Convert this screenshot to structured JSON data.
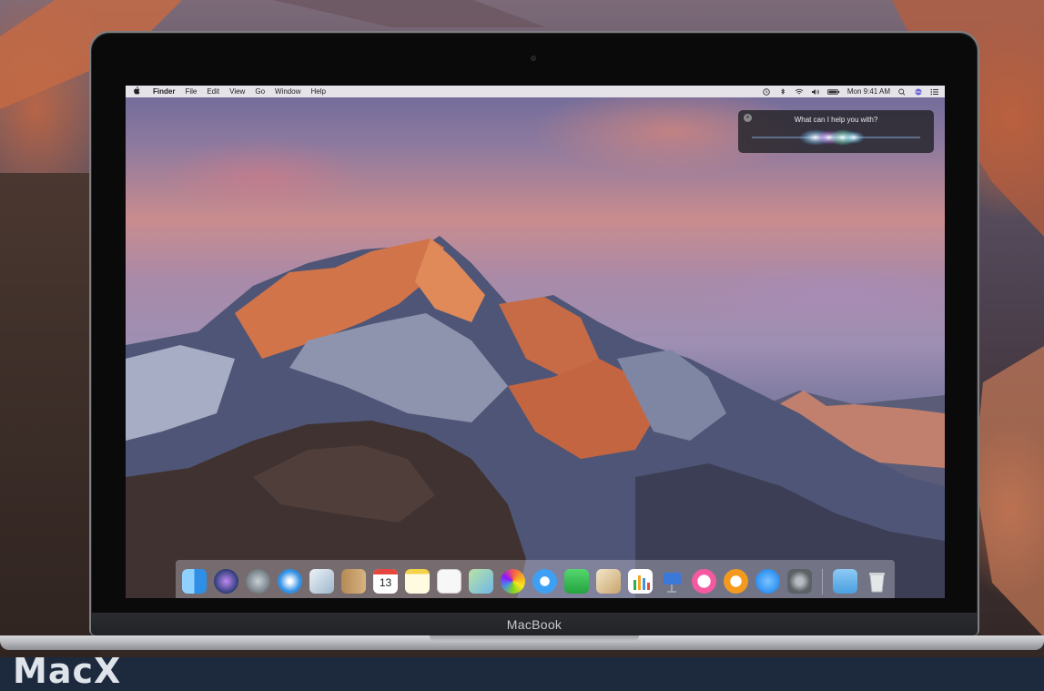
{
  "menubar": {
    "apple_label": "",
    "items": [
      "Finder",
      "File",
      "Edit",
      "View",
      "Go",
      "Window",
      "Help"
    ],
    "clock": "Mon 9:41 AM"
  },
  "siri": {
    "prompt": "What can I help you with?"
  },
  "device": {
    "label": "MacBook"
  },
  "watermark": {
    "text": "MacX"
  },
  "dock": {
    "apps": [
      {
        "name": "finder-icon",
        "color": "#4aa7f0"
      },
      {
        "name": "siri-icon",
        "color": "#2a3a78"
      },
      {
        "name": "launchpad-icon",
        "color": "#9aa4ae"
      },
      {
        "name": "safari-icon",
        "color": "#2f8fe6"
      },
      {
        "name": "mail-icon",
        "color": "#d9e2ea"
      },
      {
        "name": "contacts-icon",
        "color": "#c9a26a"
      },
      {
        "name": "calendar-icon",
        "color": "#ffffff"
      },
      {
        "name": "notes-icon",
        "color": "#f6e27a"
      },
      {
        "name": "reminders-icon",
        "color": "#f5f5f5"
      },
      {
        "name": "maps-icon",
        "color": "#7cc87a"
      },
      {
        "name": "photos-icon",
        "color": "#ffffff"
      },
      {
        "name": "messages-icon",
        "color": "#3da0f5"
      },
      {
        "name": "facetime-icon",
        "color": "#3bc25a"
      },
      {
        "name": "preview-icon",
        "color": "#e8d7b2"
      },
      {
        "name": "numbers-icon",
        "color": "#ffffff"
      },
      {
        "name": "keynote-icon",
        "color": "#3b78d8"
      },
      {
        "name": "itunes-icon",
        "color": "#f55aa0"
      },
      {
        "name": "ibooks-icon",
        "color": "#f39a1e"
      },
      {
        "name": "app-store-icon",
        "color": "#2d8ff0"
      },
      {
        "name": "system-preferences-icon",
        "color": "#6e7378"
      },
      {
        "name": "downloads-folder-icon",
        "color": "#68b2ea"
      },
      {
        "name": "trash-icon",
        "color": "#d7dadd"
      }
    ],
    "calendar_day": "13"
  }
}
